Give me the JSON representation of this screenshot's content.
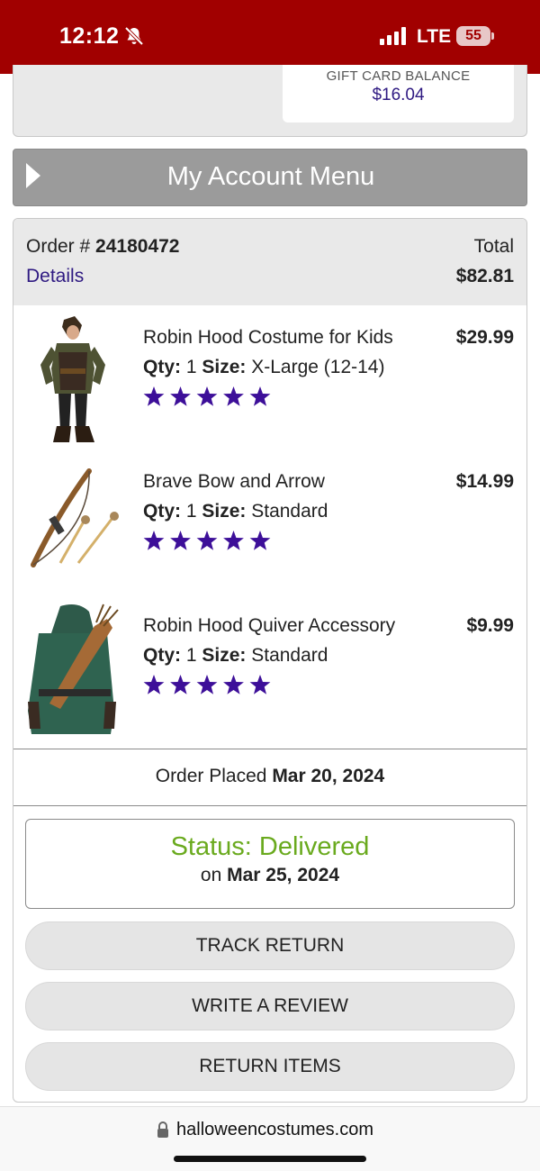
{
  "status_bar": {
    "time": "12:12",
    "network": "LTE",
    "battery": "55"
  },
  "gift_card": {
    "label": "GIFT CARD BALANCE",
    "value": "$16.04"
  },
  "menu": {
    "title": "My Account Menu"
  },
  "order": {
    "number_label": "Order #",
    "number": "24180472",
    "details_link": "Details",
    "total_label": "Total",
    "total": "$82.81",
    "items": [
      {
        "name": "Robin Hood Costume for Kids",
        "price": "$29.99",
        "qty_label": "Qty:",
        "qty": "1",
        "size_label": "Size:",
        "size": "X-Large (12-14)",
        "rating": 5
      },
      {
        "name": "Brave Bow and Arrow",
        "price": "$14.99",
        "qty_label": "Qty:",
        "qty": "1",
        "size_label": "Size:",
        "size": "Standard",
        "rating": 5
      },
      {
        "name": "Robin Hood Quiver Accessory",
        "price": "$9.99",
        "qty_label": "Qty:",
        "qty": "1",
        "size_label": "Size:",
        "size": "Standard",
        "rating": 5
      }
    ],
    "placed_label": "Order Placed",
    "placed_date": "Mar 20, 2024",
    "status": "Status: Delivered",
    "delivered_on_label": "on",
    "delivered_date": "Mar 25, 2024",
    "buttons": {
      "track_return": "TRACK RETURN",
      "write_review": "WRITE A REVIEW",
      "return_items": "RETURN ITEMS"
    }
  },
  "browser": {
    "url": "halloweencostumes.com"
  },
  "colors": {
    "status_bar": "#a10000",
    "link": "#2f1a82",
    "star": "#3d0f99",
    "delivered": "#6aaa1e",
    "menu_bar": "#9b9b9b"
  },
  "icons": {
    "silent": "bell-slash-icon",
    "signal": "signal-icon",
    "battery": "battery-icon",
    "lock": "lock-icon",
    "menu_toggle": "triangle-right-icon",
    "rating": "star-icon"
  }
}
